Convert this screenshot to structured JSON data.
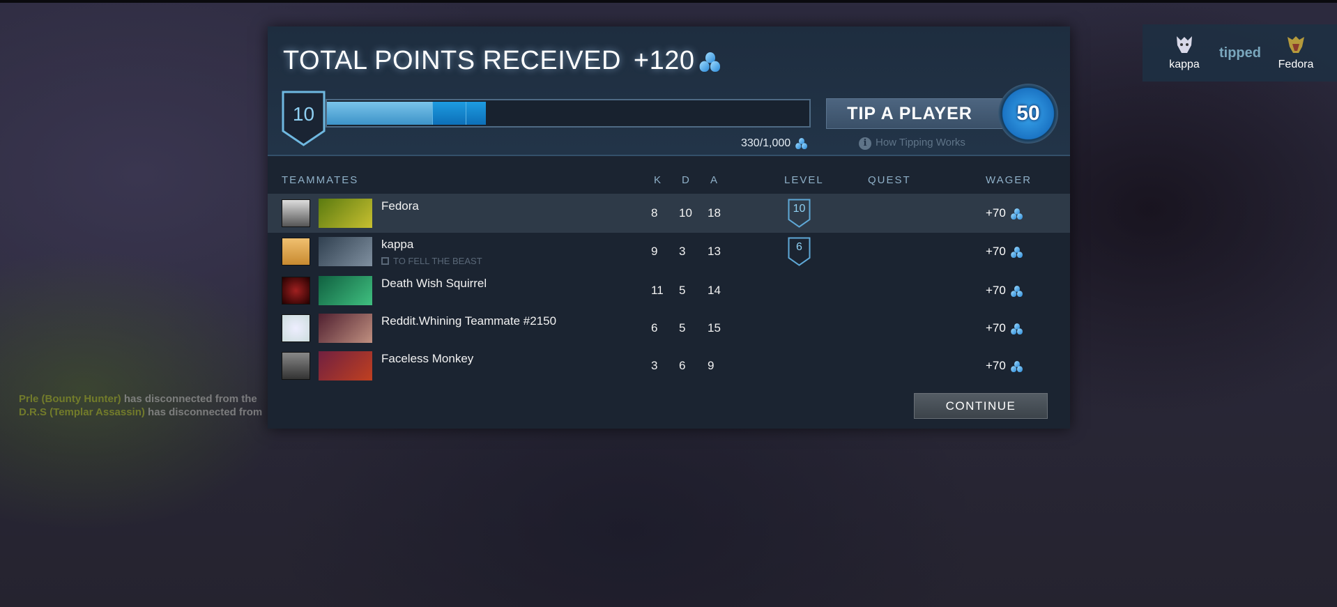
{
  "chat": [
    {
      "who": "Prle (Bounty Hunter)",
      "msg": " has disconnected from the"
    },
    {
      "who": "D.R.S (Templar Assassin)",
      "msg": " has disconnected from"
    }
  ],
  "header": {
    "title": "TOTAL POINTS RECEIVED",
    "points": "+120",
    "level": "10",
    "progress_text": "330/1,000",
    "progress_fraction": 0.33,
    "tip_button": "TIP A PLAYER",
    "tip_cost": "50",
    "how_tipping": "How Tipping Works"
  },
  "columns": {
    "teammates": "TEAMMATES",
    "k": "K",
    "d": "D",
    "a": "A",
    "level": "LEVEL",
    "quest": "QUEST",
    "wager": "WAGER"
  },
  "rows": [
    {
      "name": "Fedora",
      "k": "8",
      "d": "10",
      "a": "18",
      "level": "10",
      "quest": "",
      "wager": "+70"
    },
    {
      "name": "kappa",
      "k": "9",
      "d": "3",
      "a": "13",
      "level": "6",
      "quest": "TO FELL THE BEAST",
      "wager": "+70"
    },
    {
      "name": "Death Wish Squirrel",
      "k": "11",
      "d": "5",
      "a": "14",
      "level": "",
      "quest": "",
      "wager": "+70"
    },
    {
      "name": "Reddit.Whining Teammate #2150",
      "k": "6",
      "d": "5",
      "a": "15",
      "level": "",
      "quest": "",
      "wager": "+70"
    },
    {
      "name": "Faceless Monkey",
      "k": "3",
      "d": "6",
      "a": "9",
      "level": "",
      "quest": "",
      "wager": "+70"
    }
  ],
  "continue_label": "CONTINUE",
  "notification": {
    "from": "kappa",
    "action": "tipped",
    "to": "Fedora"
  },
  "colors": {
    "accent": "#8fd0f2",
    "panel": "#1b2431",
    "highlight_row": "#2e3a48"
  }
}
